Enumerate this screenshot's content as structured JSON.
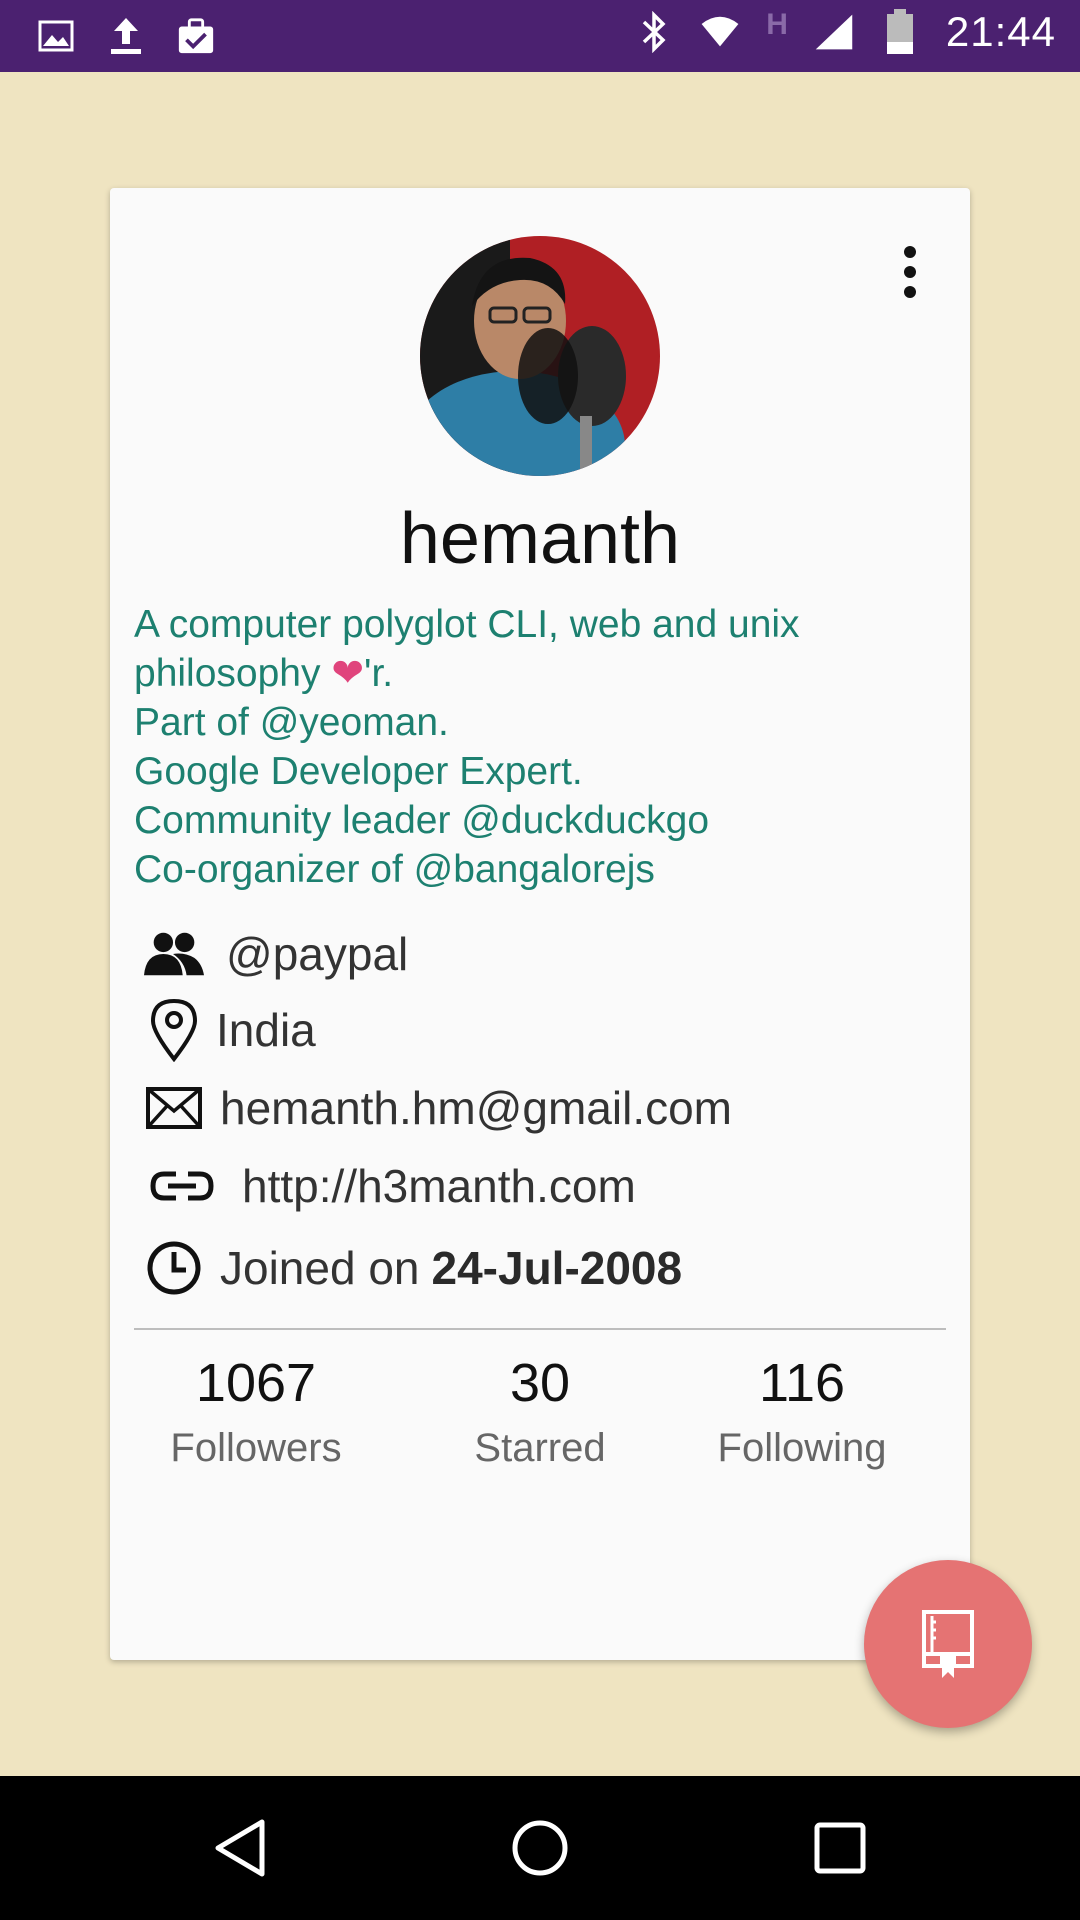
{
  "status_bar": {
    "time": "21:44",
    "network_type": "H",
    "left_icons": [
      "image-icon",
      "upload-icon",
      "clipboard-check-icon"
    ],
    "right_icons": [
      "bluetooth-icon",
      "wifi-icon",
      "signal-icon",
      "battery-icon"
    ]
  },
  "profile": {
    "username": "hemanth",
    "bio_lines": [
      "A computer polyglot CLI, web and unix",
      "philosophy",
      "'r.",
      "Part of @yeoman.",
      "Google Developer Expert.",
      "Community leader @duckduckgo",
      "Co-organizer of @bangalorejs"
    ],
    "bio_heart": "❤",
    "company": "@paypal",
    "location": "India",
    "email": "hemanth.hm@gmail.com",
    "website": "http://h3manth.com",
    "joined_prefix": "Joined on",
    "joined_date": "24-Jul-2008"
  },
  "stats": {
    "followers_count": "1067",
    "followers_label": "Followers",
    "starred_count": "30",
    "starred_label": "Starred",
    "following_count": "116",
    "following_label": "Following"
  },
  "colors": {
    "status_bar": "#4b2170",
    "background": "#efe4c1",
    "bio_text": "#1d8070",
    "fab": "#e57373",
    "heart": "#e0447c"
  }
}
